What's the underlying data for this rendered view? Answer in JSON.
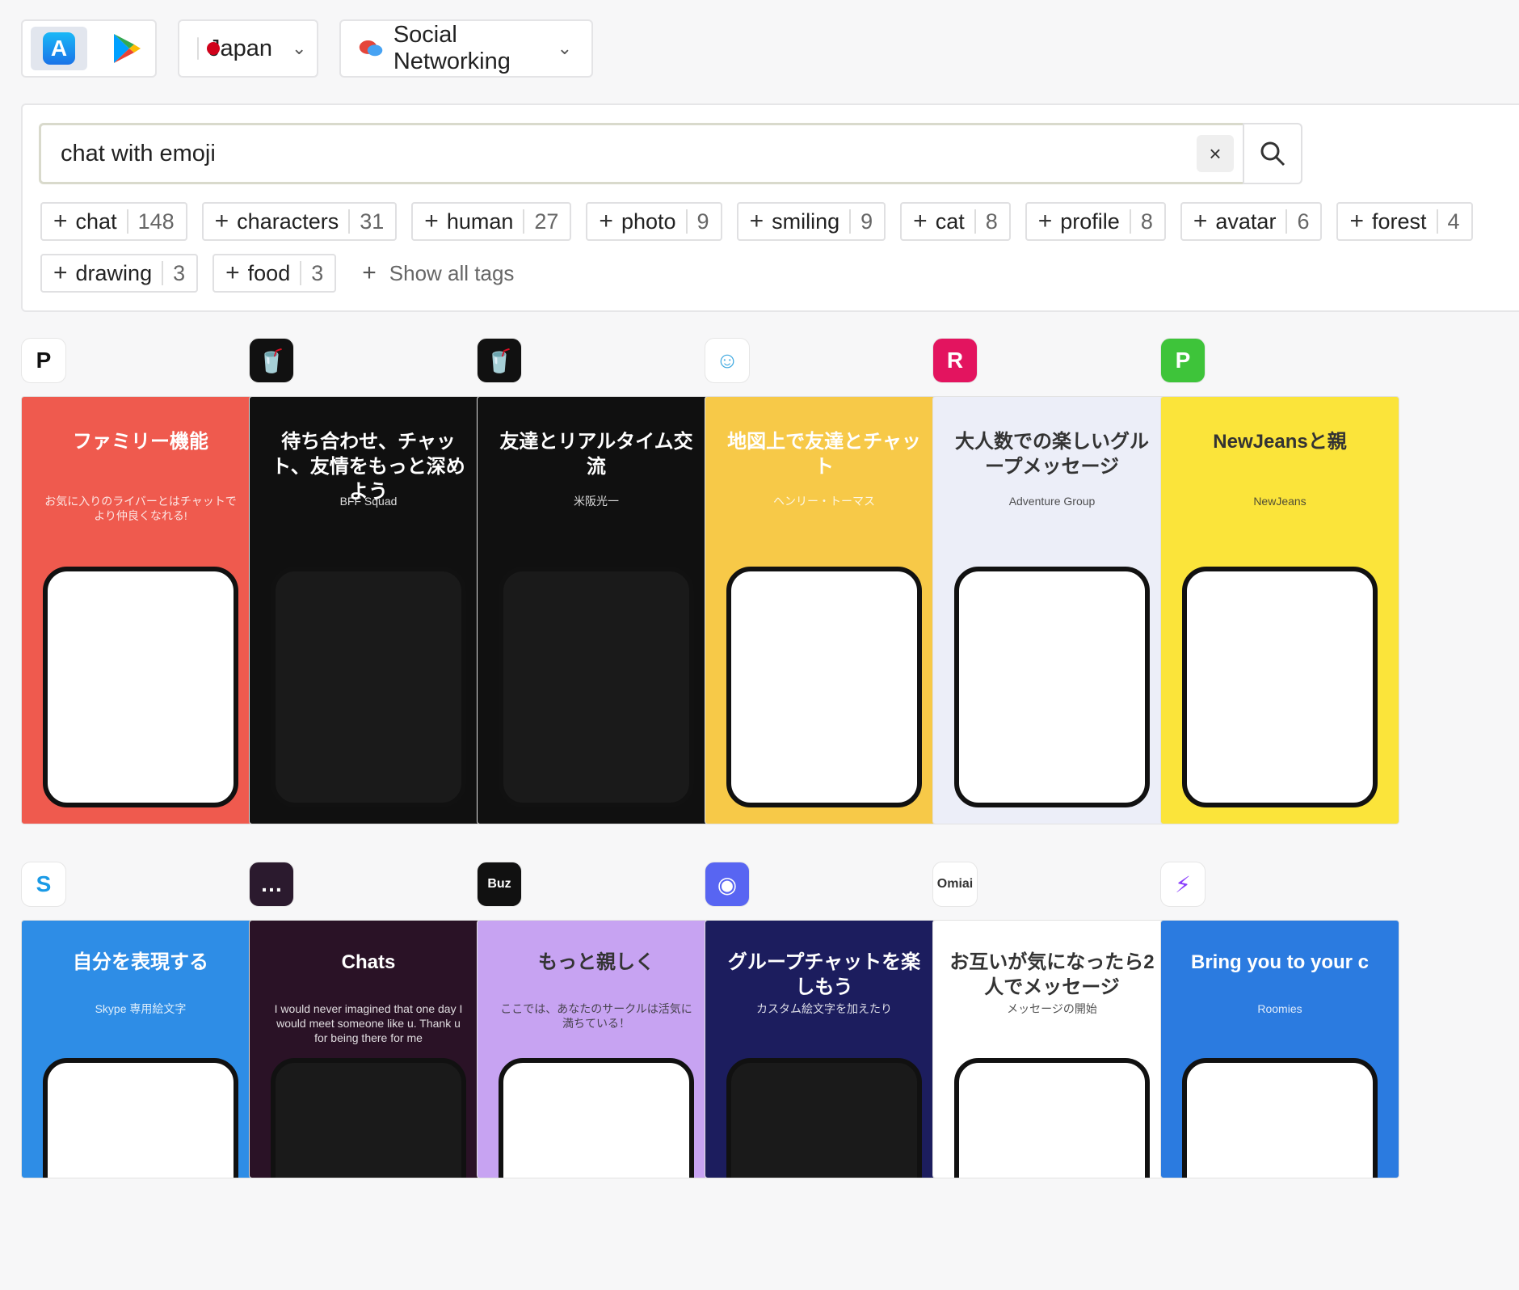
{
  "store_switch": {
    "appstore": "A",
    "googleplay": "▶"
  },
  "country": {
    "label": "Japan"
  },
  "category": {
    "label": "Social Networking"
  },
  "search": {
    "value": "chat with emoji",
    "clear": "×"
  },
  "tags": [
    {
      "label": "chat",
      "count": "148"
    },
    {
      "label": "characters",
      "count": "31"
    },
    {
      "label": "human",
      "count": "27"
    },
    {
      "label": "photo",
      "count": "9"
    },
    {
      "label": "smiling",
      "count": "9"
    },
    {
      "label": "cat",
      "count": "8"
    },
    {
      "label": "profile",
      "count": "8"
    },
    {
      "label": "avatar",
      "count": "6"
    },
    {
      "label": "forest",
      "count": "4"
    },
    {
      "label": "drawing",
      "count": "3"
    },
    {
      "label": "food",
      "count": "3"
    }
  ],
  "show_all": "Show all tags",
  "apps": [
    {
      "icon": "P",
      "icon_bg": "#ffffff",
      "icon_fg": "#111111",
      "shot_bg": "#ef5a4e",
      "title": "ファミリー機能",
      "subtitle": "お気に入りのライバーとはチャットでより仲良くなれる!"
    },
    {
      "icon": "🥤",
      "icon_bg": "#111111",
      "icon_fg": "#ffffff",
      "shot_bg": "#101010",
      "title": "待ち合わせ、チャット、友情をもっと深めよう",
      "subtitle": "BFF Squad"
    },
    {
      "icon": "🥤",
      "icon_bg": "#111111",
      "icon_fg": "#ffffff",
      "shot_bg": "#101010",
      "title": "友達とリアルタイム交流",
      "subtitle": "米阪光一"
    },
    {
      "icon": "☺",
      "icon_bg": "#ffffff",
      "icon_fg": "#3fa9e0",
      "shot_bg": "#f7c948",
      "title": "地図上で友達とチャット",
      "subtitle": "ヘンリー・トーマス"
    },
    {
      "icon": "R",
      "icon_bg": "#e3145f",
      "icon_fg": "#ffffff",
      "shot_bg": "#eceef8",
      "title": "大人数での楽しいグループメッセージ",
      "subtitle": "Adventure Group"
    },
    {
      "icon": "P",
      "icon_bg": "#3ec43a",
      "icon_fg": "#ffffff",
      "shot_bg": "#fbe43a",
      "title": "NewJeansと親",
      "subtitle": "NewJeans"
    },
    {
      "icon": "S",
      "icon_bg": "#ffffff",
      "icon_fg": "#1a9ae6",
      "shot_bg": "#2e8de6",
      "title": "自分を表現する",
      "subtitle": "Skype 専用絵文字"
    },
    {
      "icon": "…",
      "icon_bg": "#2b1a2e",
      "icon_fg": "#ffffff",
      "shot_bg": "#2a1226",
      "title": "Chats",
      "subtitle": "I would never imagined that one day I would meet someone like u. Thank u for being there for me"
    },
    {
      "icon": "Buz",
      "icon_bg": "#111111",
      "icon_fg": "#ffffff",
      "shot_bg": "#c7a3f2",
      "title": "もっと親しく",
      "subtitle": "ここでは、あなたのサークルは活気に満ちている！"
    },
    {
      "icon": "◉",
      "icon_bg": "#5865f2",
      "icon_fg": "#ffffff",
      "shot_bg": "#1c1d5e",
      "title": "グループチャットを楽しもう",
      "subtitle": "カスタム絵文字を加えたり"
    },
    {
      "icon": "Omiai",
      "icon_bg": "#ffffff",
      "icon_fg": "#333333",
      "shot_bg": "#ffffff",
      "title": "お互いが気になったら2人でメッセージ",
      "subtitle": "メッセージの開始"
    },
    {
      "icon": "⚡",
      "icon_bg": "#ffffff",
      "icon_fg": "#8a3ffc",
      "shot_bg": "#2b7be0",
      "title": "Bring you to your c",
      "subtitle": "Roomies"
    }
  ]
}
